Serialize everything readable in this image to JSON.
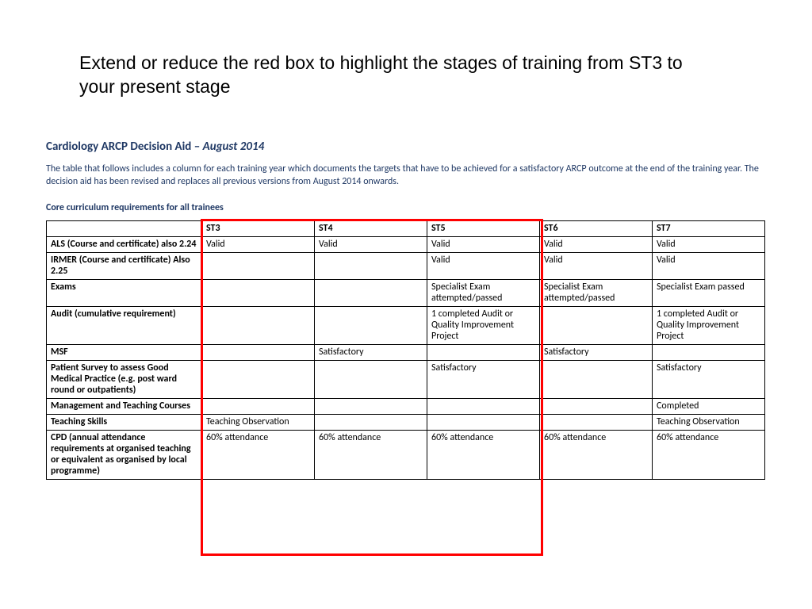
{
  "instruction": "Extend or reduce the red box to highlight the stages of training from ST3 to your present stage",
  "doc": {
    "title_prefix": "Cardiology ARCP Decision Aid – ",
    "title_em": "August 2014",
    "intro": "The table that follows includes a column for each training year which documents the targets that have to be achieved for a satisfactory ARCP outcome at the end of the training year. The decision aid has been revised and replaces all previous versions from August 2014 onwards.",
    "subheading": "Core curriculum requirements for all trainees"
  },
  "table": {
    "columns": [
      "",
      "ST3",
      "ST4",
      "ST5",
      "ST6",
      "ST7"
    ],
    "rows": [
      {
        "label": "ALS (Course and certificate) also 2.24",
        "cells": [
          "Valid",
          "Valid",
          "Valid",
          "Valid",
          "Valid"
        ]
      },
      {
        "label": "IRMER (Course and certificate) Also 2.25",
        "cells": [
          "",
          "",
          "Valid",
          "Valid",
          "Valid"
        ]
      },
      {
        "label": "Exams",
        "cells": [
          "",
          "",
          "Specialist Exam attempted/passed",
          "Specialist Exam attempted/passed",
          "Specialist Exam passed"
        ]
      },
      {
        "label": "Audit (cumulative requirement)",
        "cells": [
          "",
          "",
          "1 completed Audit or Quality Improvement Project",
          "",
          "1 completed Audit or Quality Improvement Project"
        ]
      },
      {
        "label": "MSF",
        "cells": [
          "",
          "Satisfactory",
          "",
          "Satisfactory",
          ""
        ]
      },
      {
        "label": "Patient Survey  to assess Good Medical Practice (e.g. post ward round or outpatients)",
        "cells": [
          "",
          "",
          "Satisfactory",
          "",
          "Satisfactory"
        ]
      },
      {
        "label": "Management and Teaching Courses",
        "cells": [
          "",
          "",
          "",
          "",
          "Completed"
        ]
      },
      {
        "label": "Teaching Skills",
        "cells": [
          "Teaching Observation",
          "",
          "",
          "",
          "Teaching Observation"
        ]
      },
      {
        "label": "CPD (annual attendance requirements at organised teaching or equivalent as organised by local programme)",
        "cells": [
          "60% attendance",
          "60% attendance",
          "60% attendance",
          "60% attendance",
          "60% attendance"
        ]
      }
    ]
  }
}
